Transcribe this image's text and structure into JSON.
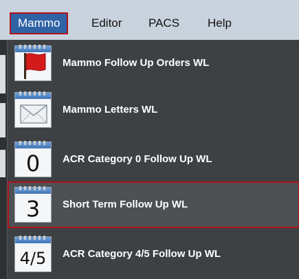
{
  "menubar": {
    "items": [
      {
        "label": "Mammo"
      },
      {
        "label": "Editor"
      },
      {
        "label": "PACS"
      },
      {
        "label": "Help"
      }
    ]
  },
  "dropdown": {
    "items": [
      {
        "label": "Mammo Follow Up Orders WL",
        "icon": "red-flag-icon"
      },
      {
        "label": "Mammo Letters WL",
        "icon": "envelope-icon"
      },
      {
        "label": "ACR Category 0 Follow Up WL",
        "icon": "calendar-0-icon",
        "icon_text": "0"
      },
      {
        "label": "Short Term Follow Up WL",
        "icon": "calendar-3-icon",
        "icon_text": "3"
      },
      {
        "label": "ACR Category 4/5 Follow Up WL",
        "icon": "calendar-4-5-icon",
        "icon_text": "4/5"
      }
    ]
  },
  "colors": {
    "menubar_bg": "#c9d3dd",
    "active_menu_bg": "#2f63a6",
    "highlight_border": "#b0131b",
    "dropdown_bg": "#3d4144"
  }
}
